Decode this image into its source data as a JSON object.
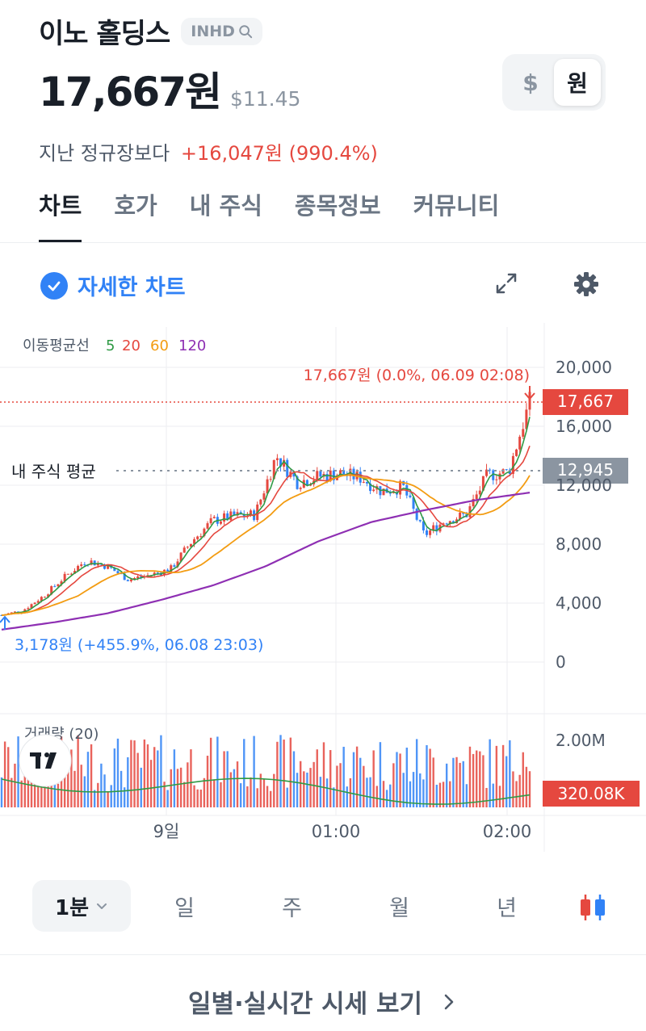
{
  "header": {
    "name": "이노 홀딩스",
    "ticker": "INHD",
    "price": "17,667원",
    "usd_price": "$11.45",
    "change_prefix": "지난 정규장보다",
    "change_value": "+16,047원 (990.4%)"
  },
  "currency": {
    "usd": "$",
    "krw": "원",
    "selected": "원"
  },
  "tabs": [
    {
      "label": "차트",
      "active": true
    },
    {
      "label": "호가",
      "active": false
    },
    {
      "label": "내 주식",
      "active": false
    },
    {
      "label": "종목정보",
      "active": false
    },
    {
      "label": "커뮤니티",
      "active": false
    }
  ],
  "detail_chart": {
    "label": "자세한 차트",
    "checked": true
  },
  "chart": {
    "ma_legend_label": "이동평균선",
    "ma_periods": [
      {
        "label": "5",
        "color": "#2f9a45"
      },
      {
        "label": "20",
        "color": "#e5483f"
      },
      {
        "label": "60",
        "color": "#f39c12"
      },
      {
        "label": "120",
        "color": "#8e2fb3"
      }
    ],
    "current_price_label": "17,667원 (0.0%, 06.09 02:08)",
    "current_price_tag": "17,667",
    "my_avg_label": "내 주식 평균",
    "my_avg_tag": "12,945",
    "low_label": "3,178원 (+455.9%, 06.08 23:03)",
    "y_ticks": [
      "20,000",
      "16,000",
      "12,000",
      "8,000",
      "4,000",
      "0"
    ],
    "volume_label": "거래량 (20)",
    "volume_ticks": [
      "2.00M"
    ],
    "volume_tag": "320.08K",
    "x_ticks": [
      "9일",
      "01:00",
      "02:00"
    ],
    "up_color": "#e5483f",
    "down_color": "#3182f6",
    "avg_color": "#8b95a1"
  },
  "chart_data": {
    "type": "candlestick",
    "ylim": [
      0,
      20000
    ],
    "y_ticks": [
      0,
      4000,
      8000,
      12000,
      16000,
      20000
    ],
    "x_ticks": [
      "9일",
      "01:00",
      "02:00"
    ],
    "current_price": 17667,
    "my_average": 12945,
    "low_point": {
      "price": 3178,
      "time": "06.08 23:03"
    },
    "close_trend": [
      3178,
      3500,
      4500,
      5800,
      6900,
      6500,
      5600,
      5900,
      6300,
      8200,
      9600,
      9900,
      10000,
      14000,
      12200,
      12600,
      12800,
      12500,
      11600,
      11900,
      8600,
      9600,
      10000,
      12700,
      12900,
      17667
    ],
    "ma120_trend": [
      2200,
      2700,
      3300,
      4200,
      5200,
      6500,
      8200,
      9500,
      10300,
      11000,
      11500
    ]
  }
}
